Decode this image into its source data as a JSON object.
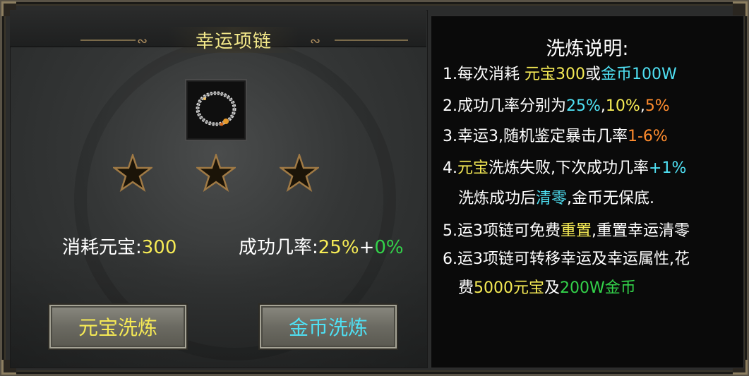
{
  "panel": {
    "title": "幸运项链",
    "item_icon": "necklace-icon",
    "stars": [
      "star-icon",
      "star-icon",
      "star-icon"
    ],
    "cost_label": "消耗元宝:",
    "cost_value": "300",
    "rate_label": "成功几率:",
    "rate_base": "25%",
    "rate_plus": "+",
    "rate_bonus": "0%",
    "btn_yuanbao": "元宝洗炼",
    "btn_jinbi": "金币洗炼"
  },
  "help": {
    "title": "洗炼说明:",
    "r1": {
      "a": "1.每次消耗 ",
      "b": "元宝300",
      "c": "或",
      "d": "金币100W"
    },
    "r2": {
      "a": "2.成功几率分别为",
      "b": "25%",
      "c": ",",
      "d": "10%",
      "e": ",",
      "f": "5%"
    },
    "r3": {
      "a": "3.幸运3,随机鉴定暴击几率",
      "b": "1-6%"
    },
    "r4": {
      "a": "4.",
      "b": "元宝",
      "c": "洗炼失败,下次成功几率",
      "d": "+1%"
    },
    "r4b": {
      "a": "洗炼成功后",
      "b": "清零",
      "c": ",金币无保底."
    },
    "r5": {
      "a": "5.运3项链可免费",
      "b": "重置",
      "c": ",重置幸运清零"
    },
    "r6": {
      "a": "6.运3项链可转移幸运及幸运属性,花"
    },
    "r6b": {
      "a": "费",
      "b": "5000元宝",
      "c": "及",
      "d": "200W金币"
    }
  },
  "colors": {
    "yellow": "#f6eb55",
    "cyan": "#4fe0f3",
    "orange": "#ff8c2e",
    "green": "#33d24a"
  }
}
